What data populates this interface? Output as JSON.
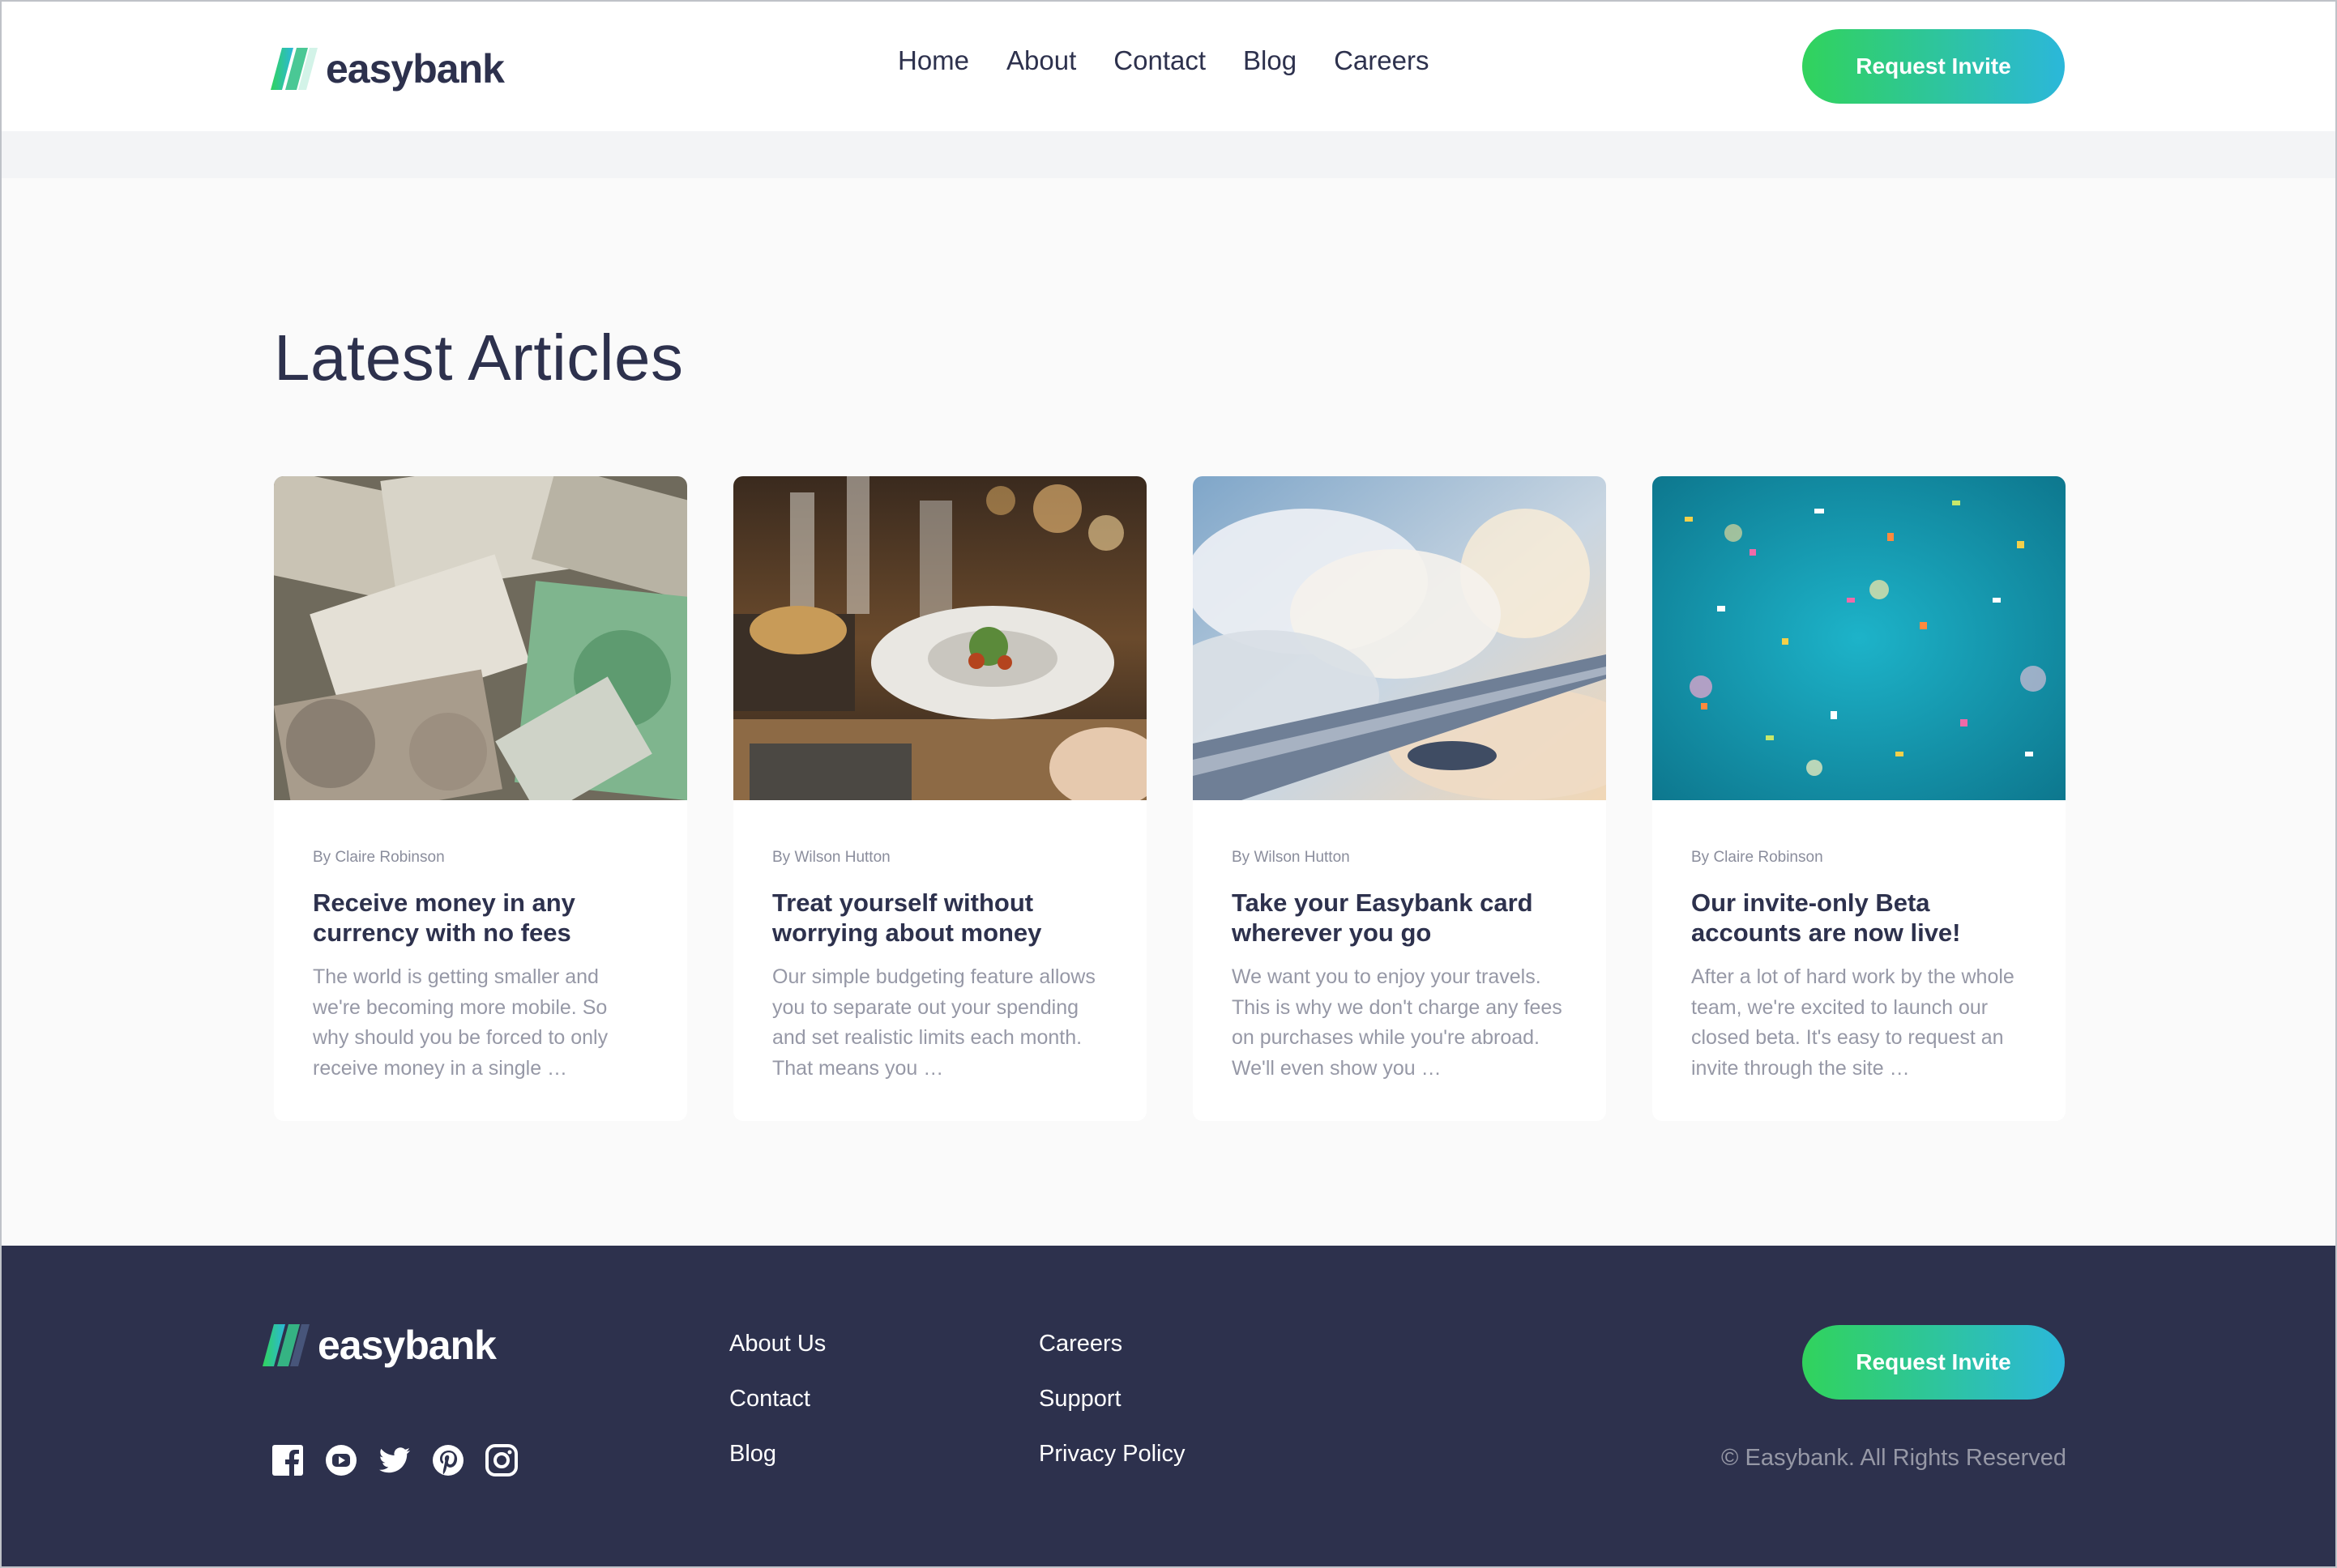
{
  "brand": {
    "name": "easybank",
    "gradient_start": "#31d35c",
    "gradient_end": "#2bb7da",
    "dark": "#2d314d"
  },
  "header": {
    "nav": [
      "Home",
      "About",
      "Contact",
      "Blog",
      "Careers"
    ],
    "cta_label": "Request Invite"
  },
  "articles": {
    "title": "Latest Articles",
    "items": [
      {
        "author": "By Claire Robinson",
        "title": "Receive money in any currency with no fees",
        "excerpt": "The world is getting smaller and we're becoming more mobile. So why should you be forced to only receive money in a single …",
        "image": "currency-banknotes-photo"
      },
      {
        "author": "By Wilson Hutton",
        "title": "Treat yourself without worrying about money",
        "excerpt": "Our simple budgeting feature allows you to separate out your spending and set realistic limits each month. That means you …",
        "image": "restaurant-dinner-photo"
      },
      {
        "author": "By Wilson Hutton",
        "title": "Take your Easybank card wherever you go",
        "excerpt": "We want you to enjoy your travels. This is why we don't charge any fees on purchases while you're abroad. We'll even show you …",
        "image": "airplane-wing-clouds-photo"
      },
      {
        "author": "By Claire Robinson",
        "title": "Our invite-only Beta accounts are now live!",
        "excerpt": "After a lot of hard work by the whole team, we're excited to launch our closed beta. It's easy to request an invite through the site …",
        "image": "confetti-photo"
      }
    ]
  },
  "footer": {
    "links_col1": [
      "About Us",
      "Contact",
      "Blog"
    ],
    "links_col2": [
      "Careers",
      "Support",
      "Privacy Policy"
    ],
    "cta_label": "Request Invite",
    "copyright": "© Easybank. All Rights Reserved",
    "socials": [
      "facebook-icon",
      "youtube-icon",
      "twitter-icon",
      "pinterest-icon",
      "instagram-icon"
    ]
  }
}
